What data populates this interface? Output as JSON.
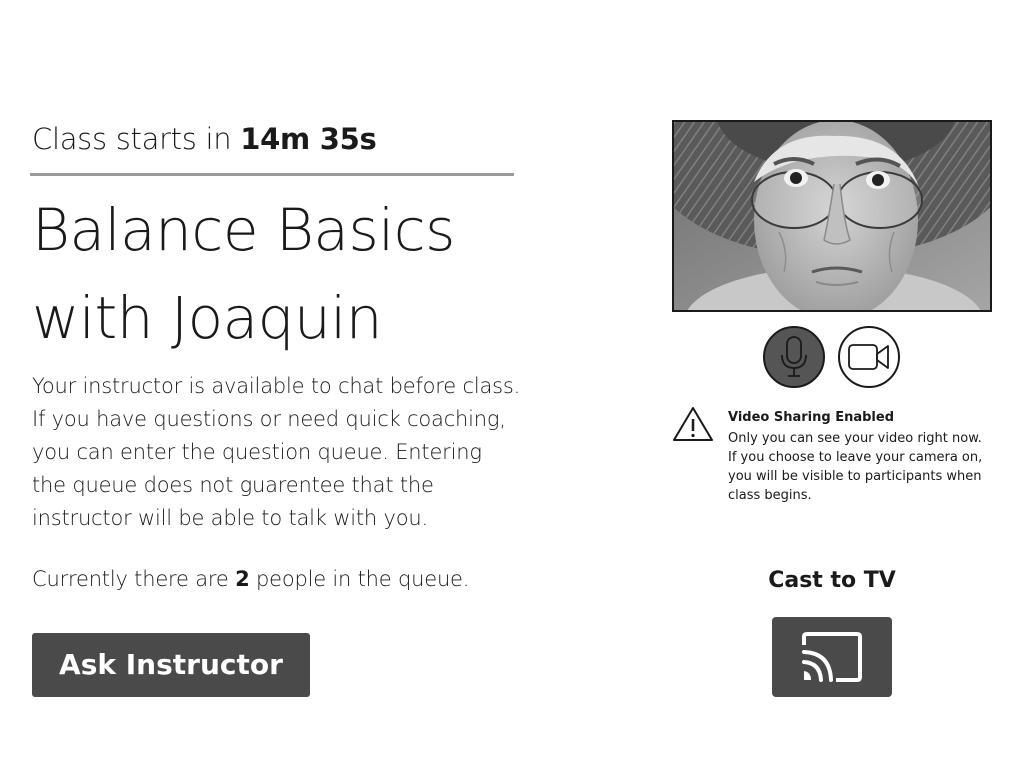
{
  "countdown": {
    "prefix": "Class starts in",
    "time": "14m 35s"
  },
  "class": {
    "title_line1": "Balance Basics",
    "title_line2": "with Joaquin",
    "description": "Your instructor is available to chat before class. If you have questions or need quick coaching, you can enter the question queue. Entering the queue does not guarentee that the instructor will be able to talk with you."
  },
  "queue": {
    "prefix": "Currently there are",
    "count": "2",
    "suffix": "people in the queue."
  },
  "ask_button": {
    "label": "Ask Instructor"
  },
  "video": {
    "mic_icon": "microphone-icon",
    "camera_icon": "video-camera-icon"
  },
  "notice": {
    "icon": "warning-triangle-icon",
    "title": "Video Sharing Enabled",
    "body": "Only you can see your video right now. If you choose to leave your camera on, you will be visible to participants when class begins."
  },
  "cast": {
    "label": "Cast to TV",
    "icon": "cast-icon"
  },
  "colors": {
    "button_bg": "#4a4a4a",
    "mic_active_bg": "#555555",
    "divider": "#9a9a9a",
    "text": "#1a1a1a"
  }
}
